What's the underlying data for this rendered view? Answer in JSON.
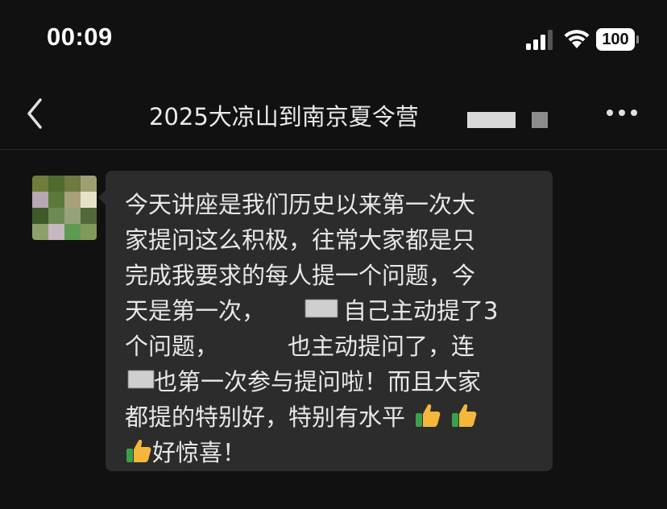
{
  "status_bar": {
    "time": "00:09",
    "battery": "100"
  },
  "nav": {
    "title": "2025大凉山到南京夏令营"
  },
  "message": {
    "lines": [
      "今天讲座是我们历史以来第一次大",
      "家提问这么积极，往常大家都是只",
      "完成我要求的每人提一个问题，今",
      "天是第一次，",
      "自己主动提了3",
      "个问题，",
      "也主动提问了，连",
      "也第一次参与提问啦！而且大家",
      "都提的特别好，特别有水平",
      "好惊喜！"
    ]
  },
  "colors": {
    "background": "#111111",
    "bubble": "#2c2c2c",
    "text": "#e8e8e8"
  },
  "icons": [
    "signal-icon",
    "wifi-icon",
    "battery-icon",
    "back-icon",
    "more-icon",
    "thumbs-up-icon"
  ]
}
